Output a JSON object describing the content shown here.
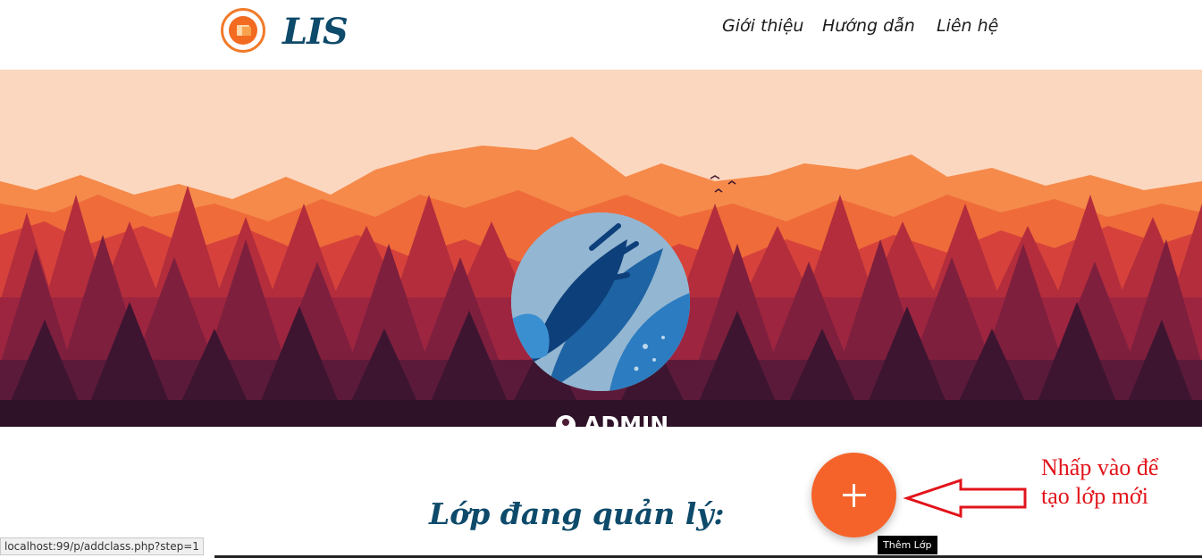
{
  "header": {
    "logo_text": "LIS",
    "nav": [
      "Giới thiệu",
      "Hướng dẫn",
      "Liên hệ"
    ]
  },
  "profile": {
    "username": "ADMIN",
    "icon": "user-circle-icon"
  },
  "main": {
    "section_title": "Lớp đang quản lý:",
    "add_button_icon": "plus-icon",
    "add_button_tooltip": "Thêm Lớp"
  },
  "annotation": {
    "line1": "Nhấp vào để",
    "line2": "tạo lớp mới",
    "color": "#e2141b"
  },
  "status_bar": {
    "url": "localhost:99/p/addclass.php?step=1"
  },
  "colors": {
    "brand": "#0e4a6a",
    "accent": "#f5632a"
  }
}
